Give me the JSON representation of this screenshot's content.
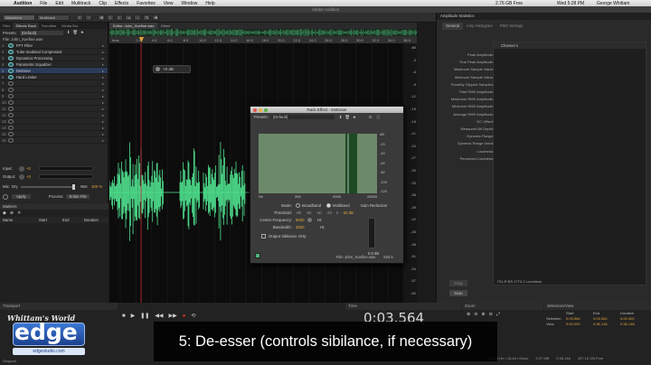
{
  "menubar": {
    "apple": "",
    "app": "Audition",
    "items": [
      "File",
      "Edit",
      "Multitrack",
      "Clip",
      "Effects",
      "Favorites",
      "View",
      "Window",
      "Help"
    ],
    "disk_free": "2.76 GB Free",
    "clock": "Wed 5:28 PM",
    "user": "George Whittam"
  },
  "window_title": "Adobe Audition",
  "toolbar": {
    "waveform": "Waveform",
    "multitrack": "Multitrack",
    "workspace_label": "Workspace:",
    "workspace_value": "Classic",
    "search_placeholder": "Search Help"
  },
  "left_panel": {
    "tabs": [
      "Files",
      "Effects Rack",
      "Favorites",
      "Media Bro"
    ],
    "presets_label": "Presets:",
    "presets_value": "(Default)",
    "file_label": "File: John_Xuefine.wav",
    "rack": [
      {
        "num": "1",
        "label": "FFT Filter"
      },
      {
        "num": "2",
        "label": "Tube-modeled Compressor"
      },
      {
        "num": "3",
        "label": "Dynamics Processing"
      },
      {
        "num": "4",
        "label": "Parametric Equalizer"
      },
      {
        "num": "5",
        "label": "DeEsser"
      },
      {
        "num": "6",
        "label": "Hard Limiter"
      },
      {
        "num": "7",
        "label": ""
      },
      {
        "num": "8",
        "label": ""
      },
      {
        "num": "9",
        "label": ""
      },
      {
        "num": "10",
        "label": ""
      },
      {
        "num": "11",
        "label": ""
      },
      {
        "num": "12",
        "label": ""
      },
      {
        "num": "13",
        "label": ""
      },
      {
        "num": "14",
        "label": ""
      },
      {
        "num": "15",
        "label": ""
      },
      {
        "num": "16",
        "label": ""
      }
    ],
    "input_label": "Input:",
    "input_value": "+0",
    "output_label": "Output:",
    "output_value": "+0",
    "mix_label": "Mix:",
    "mix_dry": "Dry",
    "mix_wet": "Wet",
    "mix_value": "100 %",
    "apply": "Apply",
    "process_label": "Process:",
    "process_value": "Entire File",
    "markers_title": "Markers",
    "markers_cols": [
      "Name",
      "Start",
      "End",
      "Duration"
    ]
  },
  "editor": {
    "tab": "Editor: John_Xuefine.wav",
    "mixer": "Mixer",
    "ruler": [
      "hms",
      "2.0",
      "4.0",
      "6.0",
      "8.0",
      "10.0",
      "12.0",
      "14.0",
      "16.0",
      "18.0",
      "20.0",
      "22.0",
      "24.0",
      "26.0",
      "28.0",
      "30.0",
      "32.0",
      "34.0",
      "36.0"
    ],
    "hud_db": "+0 dB",
    "db_scale": [
      "dB",
      "-3",
      "-6",
      "-9",
      "-12",
      "-15",
      "-18",
      "-21",
      "-24",
      "-27",
      "-30",
      "-33",
      "-36",
      "-39",
      "-42",
      "-45",
      "-48",
      "-51",
      "-54",
      "-57",
      "-60"
    ],
    "waveform_color": "#4fe28f"
  },
  "dialog": {
    "title": "Rack Effect - DeEsser",
    "presets_label": "Presets:",
    "presets_value": "(Default)",
    "freq_labels": [
      "Hz",
      "200",
      "2000",
      "20000"
    ],
    "db_labels": [
      "dB",
      "-20",
      "-40",
      "-60",
      "-80",
      "-100",
      "-120"
    ],
    "mode_label": "Mode:",
    "broadband": "Broadband",
    "multiband": "Multiband",
    "threshold_label": "Threshold:",
    "threshold_scale": [
      "-80",
      "-60",
      "-40",
      "-20",
      "0"
    ],
    "threshold_value": "-30 dB",
    "center_label": "Center Frequency:",
    "center_value": "8000",
    "center_unit": "Hz",
    "bandwidth_label": "Bandwidth:",
    "bandwidth_value": "3500",
    "bandwidth_unit": "Hz",
    "output_sibilance": "Output Sibilance Only",
    "gain_reduction_label": "Gain Reduction",
    "gain_reduction_value": "0.0 dB",
    "file_label": "File: John_Xuefine.wav",
    "slot_label": "Slot 5"
  },
  "right_panel": {
    "title": "Amplitude Statistics",
    "tabs": [
      "General",
      "Amp Histogram",
      "RMS Settings"
    ],
    "channel": "Channel 1",
    "stats": [
      "Peak Amplitude:",
      "True Peak Amplitude:",
      "Maximum Sample Value:",
      "Minimum Sample Value:",
      "Possibly Clipped Samples:",
      "Total RMS Amplitude:",
      "Maximum RMS Amplitude:",
      "Minimum RMS Amplitude:",
      "Average RMS Amplitude:",
      "DC Offset:",
      "Measured Bit Depth:",
      "Dynamic Range:",
      "Dynamic Range Used:",
      "Loudness:",
      "Perceived Loudness:"
    ],
    "standard": "ITU-R BS.1770-2 Loudness",
    "scan": "Scan",
    "copy": "Copy"
  },
  "bottom": {
    "transport": "Transport",
    "time_title": "Time",
    "time": "0:03.564",
    "zoom": "Zoom",
    "selection_title": "Selection/View",
    "sel_cols": [
      "Start",
      "End",
      "Duration"
    ],
    "sel_rows": [
      {
        "label": "Selection",
        "start": "0:03.564",
        "end": "0:03.564",
        "dur": "0:00.000"
      },
      {
        "label": "View",
        "start": "0:00.000",
        "end": "0:36.148",
        "dur": "0:36.148"
      }
    ],
    "status": "44100 Hz • 16-bit • Mono",
    "status_size": "3.07 MB",
    "status_dur": "0:36.148",
    "status_free": "407.16 GB Free",
    "stopped": "Stopped"
  },
  "caption": "5:  De-esser (controls sibilance, if necessary)",
  "logo": {
    "top": "Whittam's World",
    "main": "edge",
    "bottom": "edgestudio.com"
  }
}
